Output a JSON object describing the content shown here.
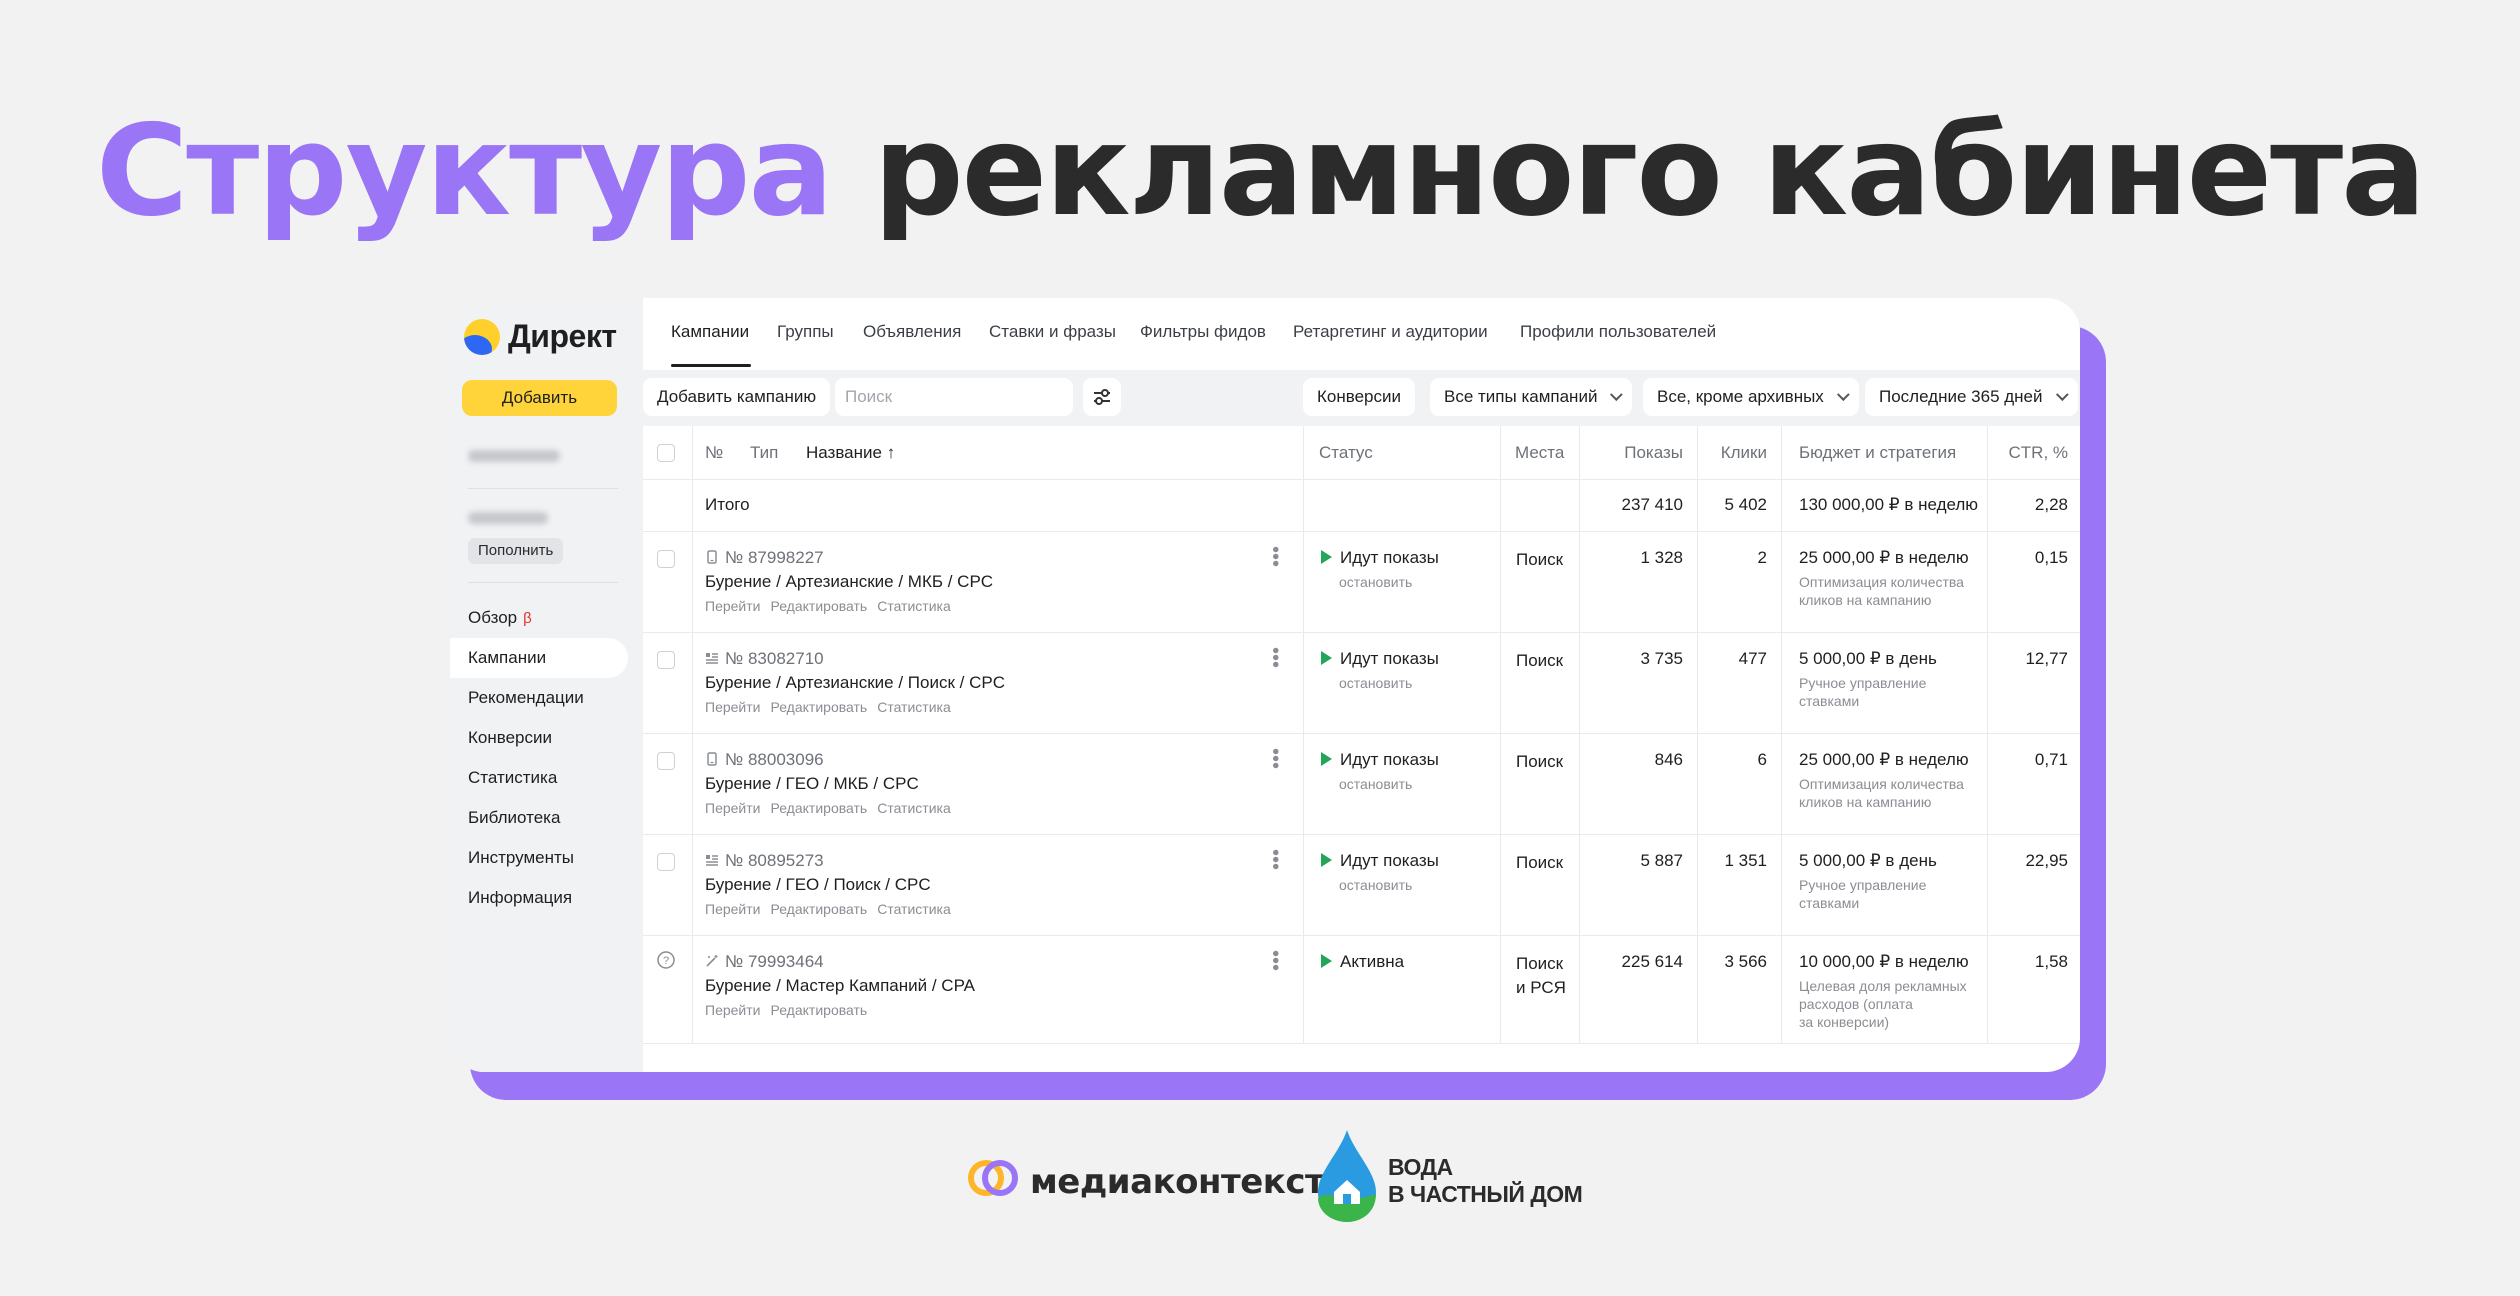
{
  "headline": {
    "accent": "Структура",
    "rest": "рекламного кабинета"
  },
  "sidebar": {
    "logo": "Директ",
    "add_button": "Добавить",
    "topup_button": "Пополнить",
    "nav": [
      {
        "label": "Обзор",
        "badge": "β"
      },
      {
        "label": "Кампании",
        "active": true
      },
      {
        "label": "Рекомендации"
      },
      {
        "label": "Конверсии"
      },
      {
        "label": "Статистика"
      },
      {
        "label": "Библиотека"
      },
      {
        "label": "Инструменты"
      },
      {
        "label": "Информация"
      }
    ]
  },
  "tabs": [
    "Кампании",
    "Группы",
    "Объявления",
    "Ставки и фразы",
    "Фильтры фидов",
    "Ретаргетинг и аудитории",
    "Профили пользователей"
  ],
  "toolbar": {
    "add_campaign": "Добавить кампанию",
    "search_placeholder": "Поиск",
    "conversions": "Конверсии",
    "campaign_types": "Все типы кампаний",
    "archive_filter": "Все, кроме архивных",
    "period": "Последние 365 дней"
  },
  "table": {
    "headers": {
      "num": "№",
      "type": "Тип",
      "name": "Название ↑",
      "status": "Статус",
      "places": "Места",
      "shows": "Показы",
      "clicks": "Клики",
      "budget": "Бюджет и стратегия",
      "ctr": "CTR, %"
    },
    "total": {
      "label": "Итого",
      "shows": "237 410",
      "clicks": "5 402",
      "budget": "130 000,00 ₽ в неделю",
      "ctr": "2,28"
    },
    "rows": [
      {
        "id": "№ 87998227",
        "name": "Бурение / Артезианские / МКБ / CPC",
        "links": [
          "Перейти",
          "Редактировать",
          "Статистика"
        ],
        "status": "Идут показы",
        "status_action": "остановить",
        "places": "Поиск",
        "shows": "1 328",
        "clicks": "2",
        "budget": "25 000,00 ₽ в неделю",
        "strategy": "Оптимизация количества кликов на кампанию",
        "ctr": "0,15",
        "type_icon": "mobile-icon"
      },
      {
        "id": "№ 83082710",
        "name": "Бурение / Артезианские / Поиск / CPC",
        "links": [
          "Перейти",
          "Редактировать",
          "Статистика"
        ],
        "status": "Идут показы",
        "status_action": "остановить",
        "places": "Поиск",
        "shows": "3 735",
        "clicks": "477",
        "budget": "5 000,00 ₽ в день",
        "strategy": "Ручное управление ставками",
        "ctr": "12,77",
        "type_icon": "text-ad-icon"
      },
      {
        "id": "№ 88003096",
        "name": "Бурение / ГЕО / МКБ / CPC",
        "links": [
          "Перейти",
          "Редактировать",
          "Статистика"
        ],
        "status": "Идут показы",
        "status_action": "остановить",
        "places": "Поиск",
        "shows": "846",
        "clicks": "6",
        "budget": "25 000,00 ₽ в неделю",
        "strategy": "Оптимизация количества кликов на кампанию",
        "ctr": "0,71",
        "type_icon": "mobile-icon"
      },
      {
        "id": "№ 80895273",
        "name": "Бурение / ГЕО / Поиск / CPC",
        "links": [
          "Перейти",
          "Редактировать",
          "Статистика"
        ],
        "status": "Идут показы",
        "status_action": "остановить",
        "places": "Поиск",
        "shows": "5 887",
        "clicks": "1 351",
        "budget": "5 000,00 ₽ в день",
        "strategy": "Ручное управление ставками",
        "ctr": "22,95",
        "type_icon": "text-ad-icon"
      },
      {
        "id": "№ 79993464",
        "name": "Бурение / Мастер Кампаний / CPA",
        "links": [
          "Перейти",
          "Редактировать"
        ],
        "status": "Активна",
        "status_action": "",
        "places": "Поиск и РСЯ",
        "places_line1": "Поиск",
        "places_line2": "и РСЯ",
        "shows": "225 614",
        "clicks": "3 566",
        "budget": "10 000,00 ₽ в неделю",
        "strategy": "Целевая доля рекламных расходов (оплата за конверсии)",
        "strategy_lines": [
          "Целевая доля рекламных",
          "расходов (оплата",
          "за конверсии)"
        ],
        "ctr": "1,58",
        "type_icon": "wand-icon"
      }
    ]
  },
  "footer": {
    "brand1": "медиаконтекст",
    "brand2_line1": "ВОДА",
    "brand2_line2": "В ЧАСТНЫЙ ДОМ"
  },
  "colors": {
    "accent": "#9a75f5",
    "add_button": "#ffd43a",
    "status_green": "#23a55a"
  }
}
